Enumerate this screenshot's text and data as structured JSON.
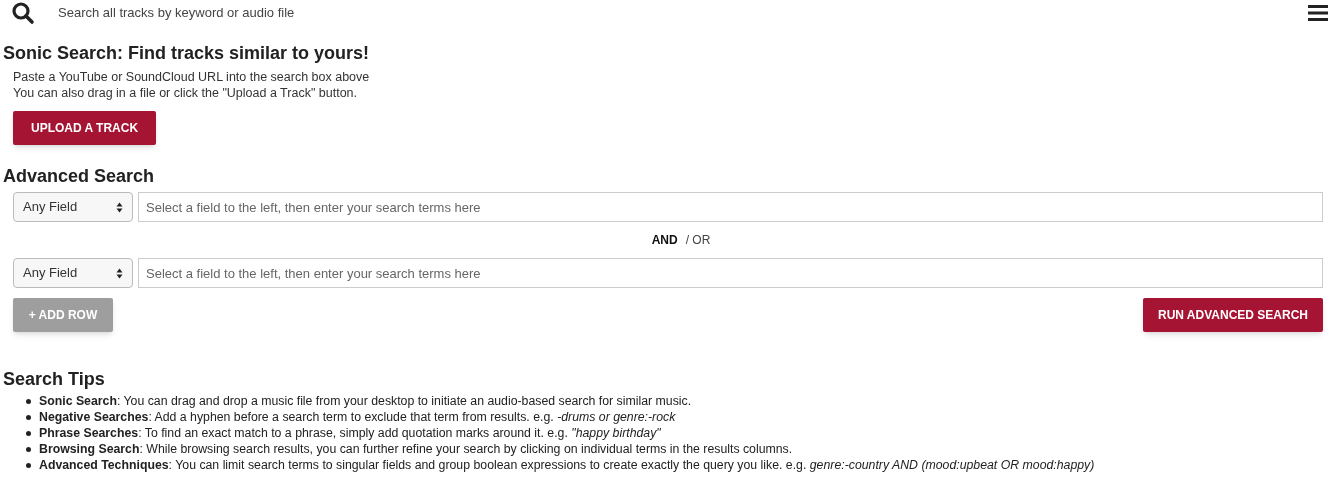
{
  "top_bar": {
    "search_placeholder": "Search all tracks by keyword or audio file"
  },
  "sonic_search": {
    "title": "Sonic Search: Find tracks similar to yours!",
    "lines": [
      "Paste a YouTube or SoundCloud URL into the search box above",
      "You can also drag in a file or click the \"Upload a Track\" button."
    ],
    "button": "UPLOAD A TRACK"
  },
  "advanced_search": {
    "title": "Advanced Search",
    "rows": [
      {
        "field": "Any Field",
        "placeholder": "Select a field to the left, then enter your search terms here"
      },
      {
        "field": "Any Field",
        "placeholder": "Select a field to the left, then enter your search terms here"
      }
    ],
    "logic": [
      {
        "label": "AND",
        "selected": true
      },
      {
        "label": "/ OR",
        "selected": false
      }
    ],
    "add_row_button": "+ ADD ROW",
    "run_button": "RUN ADVANCED SEARCH"
  },
  "search_tips": {
    "title": "Search Tips",
    "items": [
      "**Sonic Search**: You can drag and drop a music file from your desktop to initiate an audio-based search for similar music.",
      "**Negative Searches**: Add a hyphen before a search term to exclude that term from results. e.g. *-drums or genre:-rock*",
      "**Phrase Searches**: To find an exact match to a phrase, simply add quotation marks around it. e.g. *\"happy birthday\"*",
      "**Browsing Search**: While browsing search results, you can further refine your search by clicking on individual terms in the results columns.",
      "**Advanced Techniques**: You can limit search terms to singular fields and group boolean expressions to create exactly the query you like. e.g. *genre:-country AND (mood:upbeat OR mood:happy)*"
    ]
  }
}
